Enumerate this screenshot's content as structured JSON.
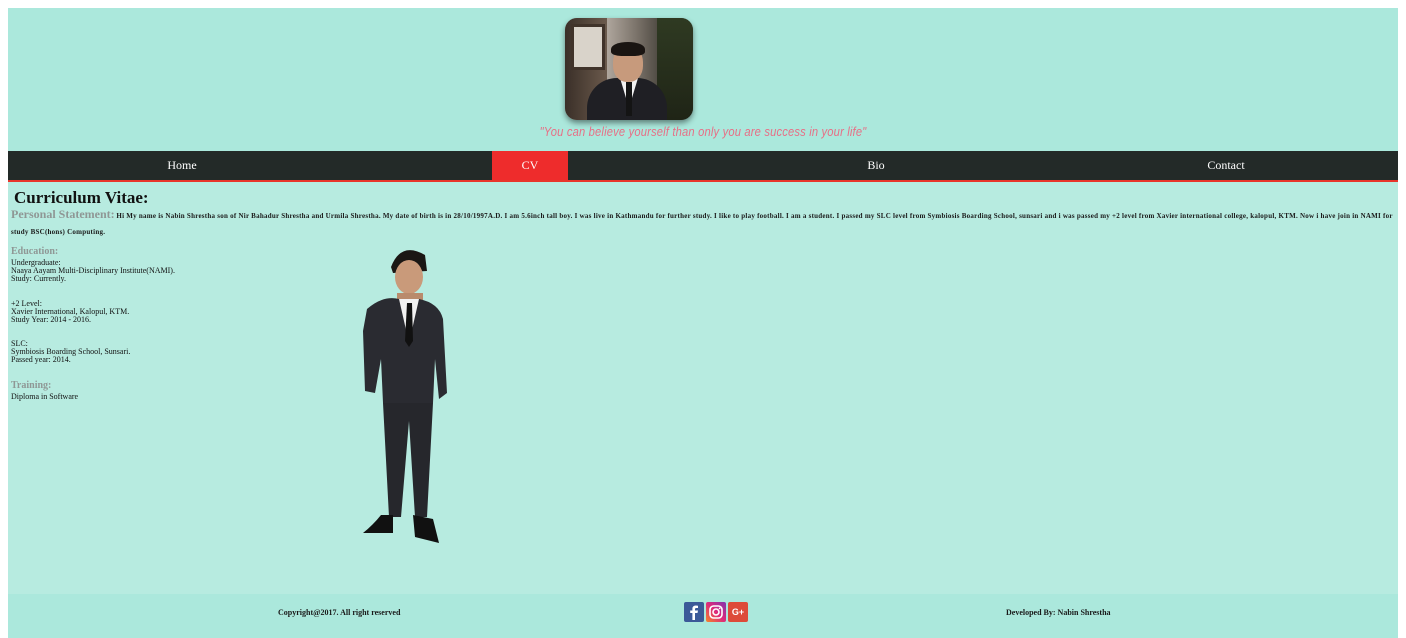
{
  "header": {
    "motto": "\"You can believe yourself than only you are success in your life\""
  },
  "nav": {
    "items": [
      {
        "label": "Home"
      },
      {
        "label": "CV"
      },
      {
        "label": "Bio"
      },
      {
        "label": "Contact"
      }
    ],
    "active": "CV"
  },
  "cv": {
    "title": "Curriculum Vitae:",
    "statement_label": "Personal Statement:",
    "statement_text": "Hi My name is Nabin Shrestha son of Nir Bahadur Shrestha and Urmila Shrestha. My date of birth is in 28/10/1997A.D. I am 5.6inch tall boy. I was live in Kathmandu for further study. I like to play football. I am a student. I passed my SLC level from Symbiosis Boarding School, sunsari and i was passed my +2 level from Xavier international college, kalopul, KTM. Now i have join in NAMI for study BSC(hons) Computing.",
    "education_label": "Education:",
    "undergraduate": [
      "Undergraduate:",
      "Naaya Aayam Multi-Disciplinary Institute(NAMI).",
      "Study: Currently."
    ],
    "plus_two": [
      "+2 Level:",
      "Xavier International, Kalopul, KTM.",
      "Study Year: 2014 - 2016."
    ],
    "slc": [
      "SLC:",
      "Symbiosis Boarding School, Sunsari.",
      "Passed year: 2014."
    ],
    "training_label": "Training:",
    "training": [
      "Diploma in Software"
    ]
  },
  "footer": {
    "copyright": "Copyright@2017. All right reserved",
    "developer": "Developed By: Nabin Shrestha",
    "social": [
      "facebook-icon",
      "instagram-icon",
      "google-plus-icon"
    ],
    "gplus_text": "G+"
  },
  "colors": {
    "background": "#b7ebe0",
    "header": "#abe8dc",
    "nav": "#232a28",
    "active": "#ee2c2c",
    "motto": "#e76f86",
    "label": "#8f9795"
  }
}
